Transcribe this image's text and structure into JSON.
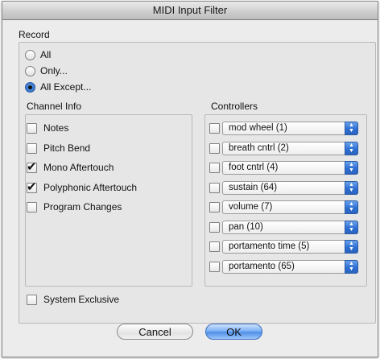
{
  "window": {
    "title": "MIDI Input Filter"
  },
  "record": {
    "label": "Record",
    "options": [
      {
        "label": "All",
        "selected": false
      },
      {
        "label": "Only...",
        "selected": false
      },
      {
        "label": "All Except...",
        "selected": true
      }
    ]
  },
  "channel_info": {
    "label": "Channel Info",
    "items": [
      {
        "label": "Notes",
        "checked": false
      },
      {
        "label": "Pitch Bend",
        "checked": false
      },
      {
        "label": "Mono Aftertouch",
        "checked": true
      },
      {
        "label": "Polyphonic Aftertouch",
        "checked": true
      },
      {
        "label": "Program Changes",
        "checked": false
      }
    ]
  },
  "controllers": {
    "label": "Controllers",
    "items": [
      {
        "value": "mod wheel (1)",
        "checked": false
      },
      {
        "value": "breath cntrl (2)",
        "checked": false
      },
      {
        "value": "foot cntrl (4)",
        "checked": false
      },
      {
        "value": "sustain (64)",
        "checked": false
      },
      {
        "value": "volume (7)",
        "checked": false
      },
      {
        "value": "pan (10)",
        "checked": false
      },
      {
        "value": "portamento time (5)",
        "checked": false
      },
      {
        "value": "portamento (65)",
        "checked": false
      }
    ]
  },
  "system_exclusive": {
    "label": "System Exclusive",
    "checked": false
  },
  "buttons": {
    "cancel": "Cancel",
    "ok": "OK"
  },
  "colors": {
    "accent": "#3f7fd6",
    "window_bg": "#ececec"
  }
}
